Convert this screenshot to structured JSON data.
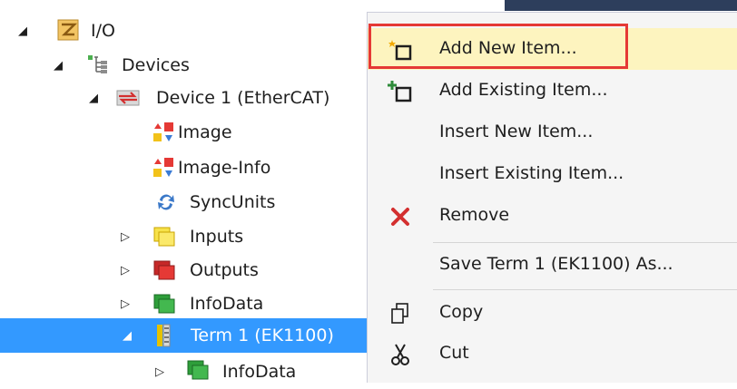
{
  "tree": {
    "items": [
      {
        "label": "I/O",
        "icon": "io-folder-icon",
        "expander": "◢"
      },
      {
        "label": "Devices",
        "icon": "devices-icon",
        "expander": "◢"
      },
      {
        "label": "Device 1 (EtherCAT)",
        "icon": "ethercat-device-icon",
        "expander": "◢"
      },
      {
        "label": "Image",
        "icon": "image-icon",
        "expander": ""
      },
      {
        "label": "Image-Info",
        "icon": "image-info-icon",
        "expander": ""
      },
      {
        "label": "SyncUnits",
        "icon": "sync-units-icon",
        "expander": ""
      },
      {
        "label": "Inputs",
        "icon": "inputs-icon",
        "expander": "▷"
      },
      {
        "label": "Outputs",
        "icon": "outputs-icon",
        "expander": "▷"
      },
      {
        "label": "InfoData",
        "icon": "infodata-icon",
        "expander": "▷"
      },
      {
        "label": "Term 1 (EK1100)",
        "icon": "terminal-icon",
        "expander": "◢"
      },
      {
        "label": "InfoData",
        "icon": "infodata-icon",
        "expander": "▷"
      }
    ]
  },
  "context_menu": {
    "items": [
      {
        "label": "Add New Item...",
        "icon": "add-new-item-icon"
      },
      {
        "label": "Add Existing Item...",
        "icon": "add-existing-item-icon"
      },
      {
        "label": "Insert New Item...",
        "icon": ""
      },
      {
        "label": "Insert Existing Item...",
        "icon": ""
      },
      {
        "label": "Remove",
        "icon": "remove-icon"
      },
      {
        "label": "Save Term 1 (EK1100) As...",
        "icon": ""
      },
      {
        "label": "Copy",
        "icon": "copy-icon"
      },
      {
        "label": "Cut",
        "icon": "cut-icon"
      }
    ]
  },
  "colors": {
    "selection": "#3399ff",
    "highlight_border": "#e53935",
    "menu_hover": "#fdf4bf",
    "menu_bg": "#f5f5f5"
  }
}
